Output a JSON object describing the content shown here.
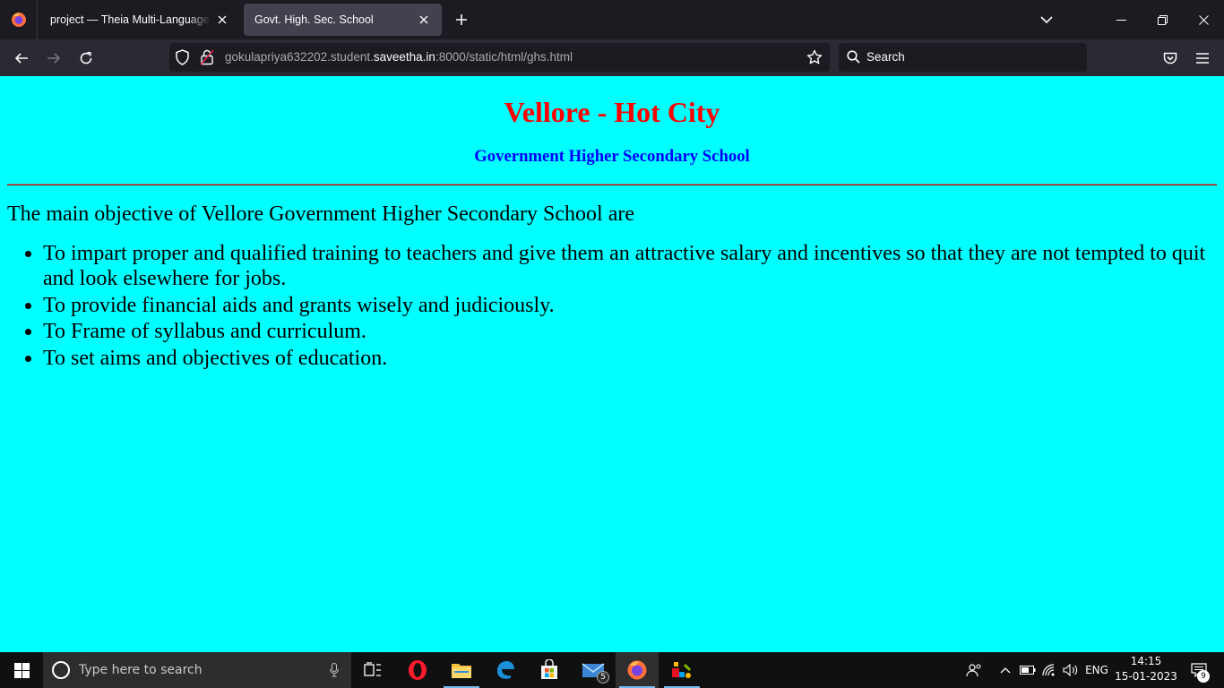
{
  "browser": {
    "tabs": [
      {
        "title": "project — Theia Multi-Language Exp",
        "active": false
      },
      {
        "title": "Govt. High. Sec. School",
        "active": true
      }
    ],
    "url": {
      "prefix": "gokulapriya632202.student.",
      "host": "saveetha.in",
      "suffix": ":8000/static/html/ghs.html"
    },
    "search_placeholder": "Search"
  },
  "page": {
    "background": "#00ffff",
    "title": "Vellore - Hot City",
    "title_color": "#ff0000",
    "subtitle": "Government Higher Secondary School",
    "subtitle_color": "#0000ff",
    "intro": "The main objective of Vellore Government Higher Secondary School are",
    "objectives": [
      "To impart proper and qualified training to teachers and give them an attractive salary and incentives so that they are not tempted to quit and look elsewhere for jobs.",
      "To provide financial aids and grants wisely and judiciously.",
      "To Frame of syllabus and curriculum.",
      "To set aims and objectives of education."
    ]
  },
  "taskbar": {
    "search_placeholder": "Type here to search",
    "mail_badge": "5",
    "language": "ENG",
    "time": "14:15",
    "date": "15-01-2023",
    "notification_count": "9",
    "apps": [
      "task-view-icon",
      "opera-icon",
      "file-explorer-icon",
      "edge-icon",
      "store-icon",
      "mail-icon",
      "firefox-icon",
      "paint-app-icon"
    ]
  }
}
